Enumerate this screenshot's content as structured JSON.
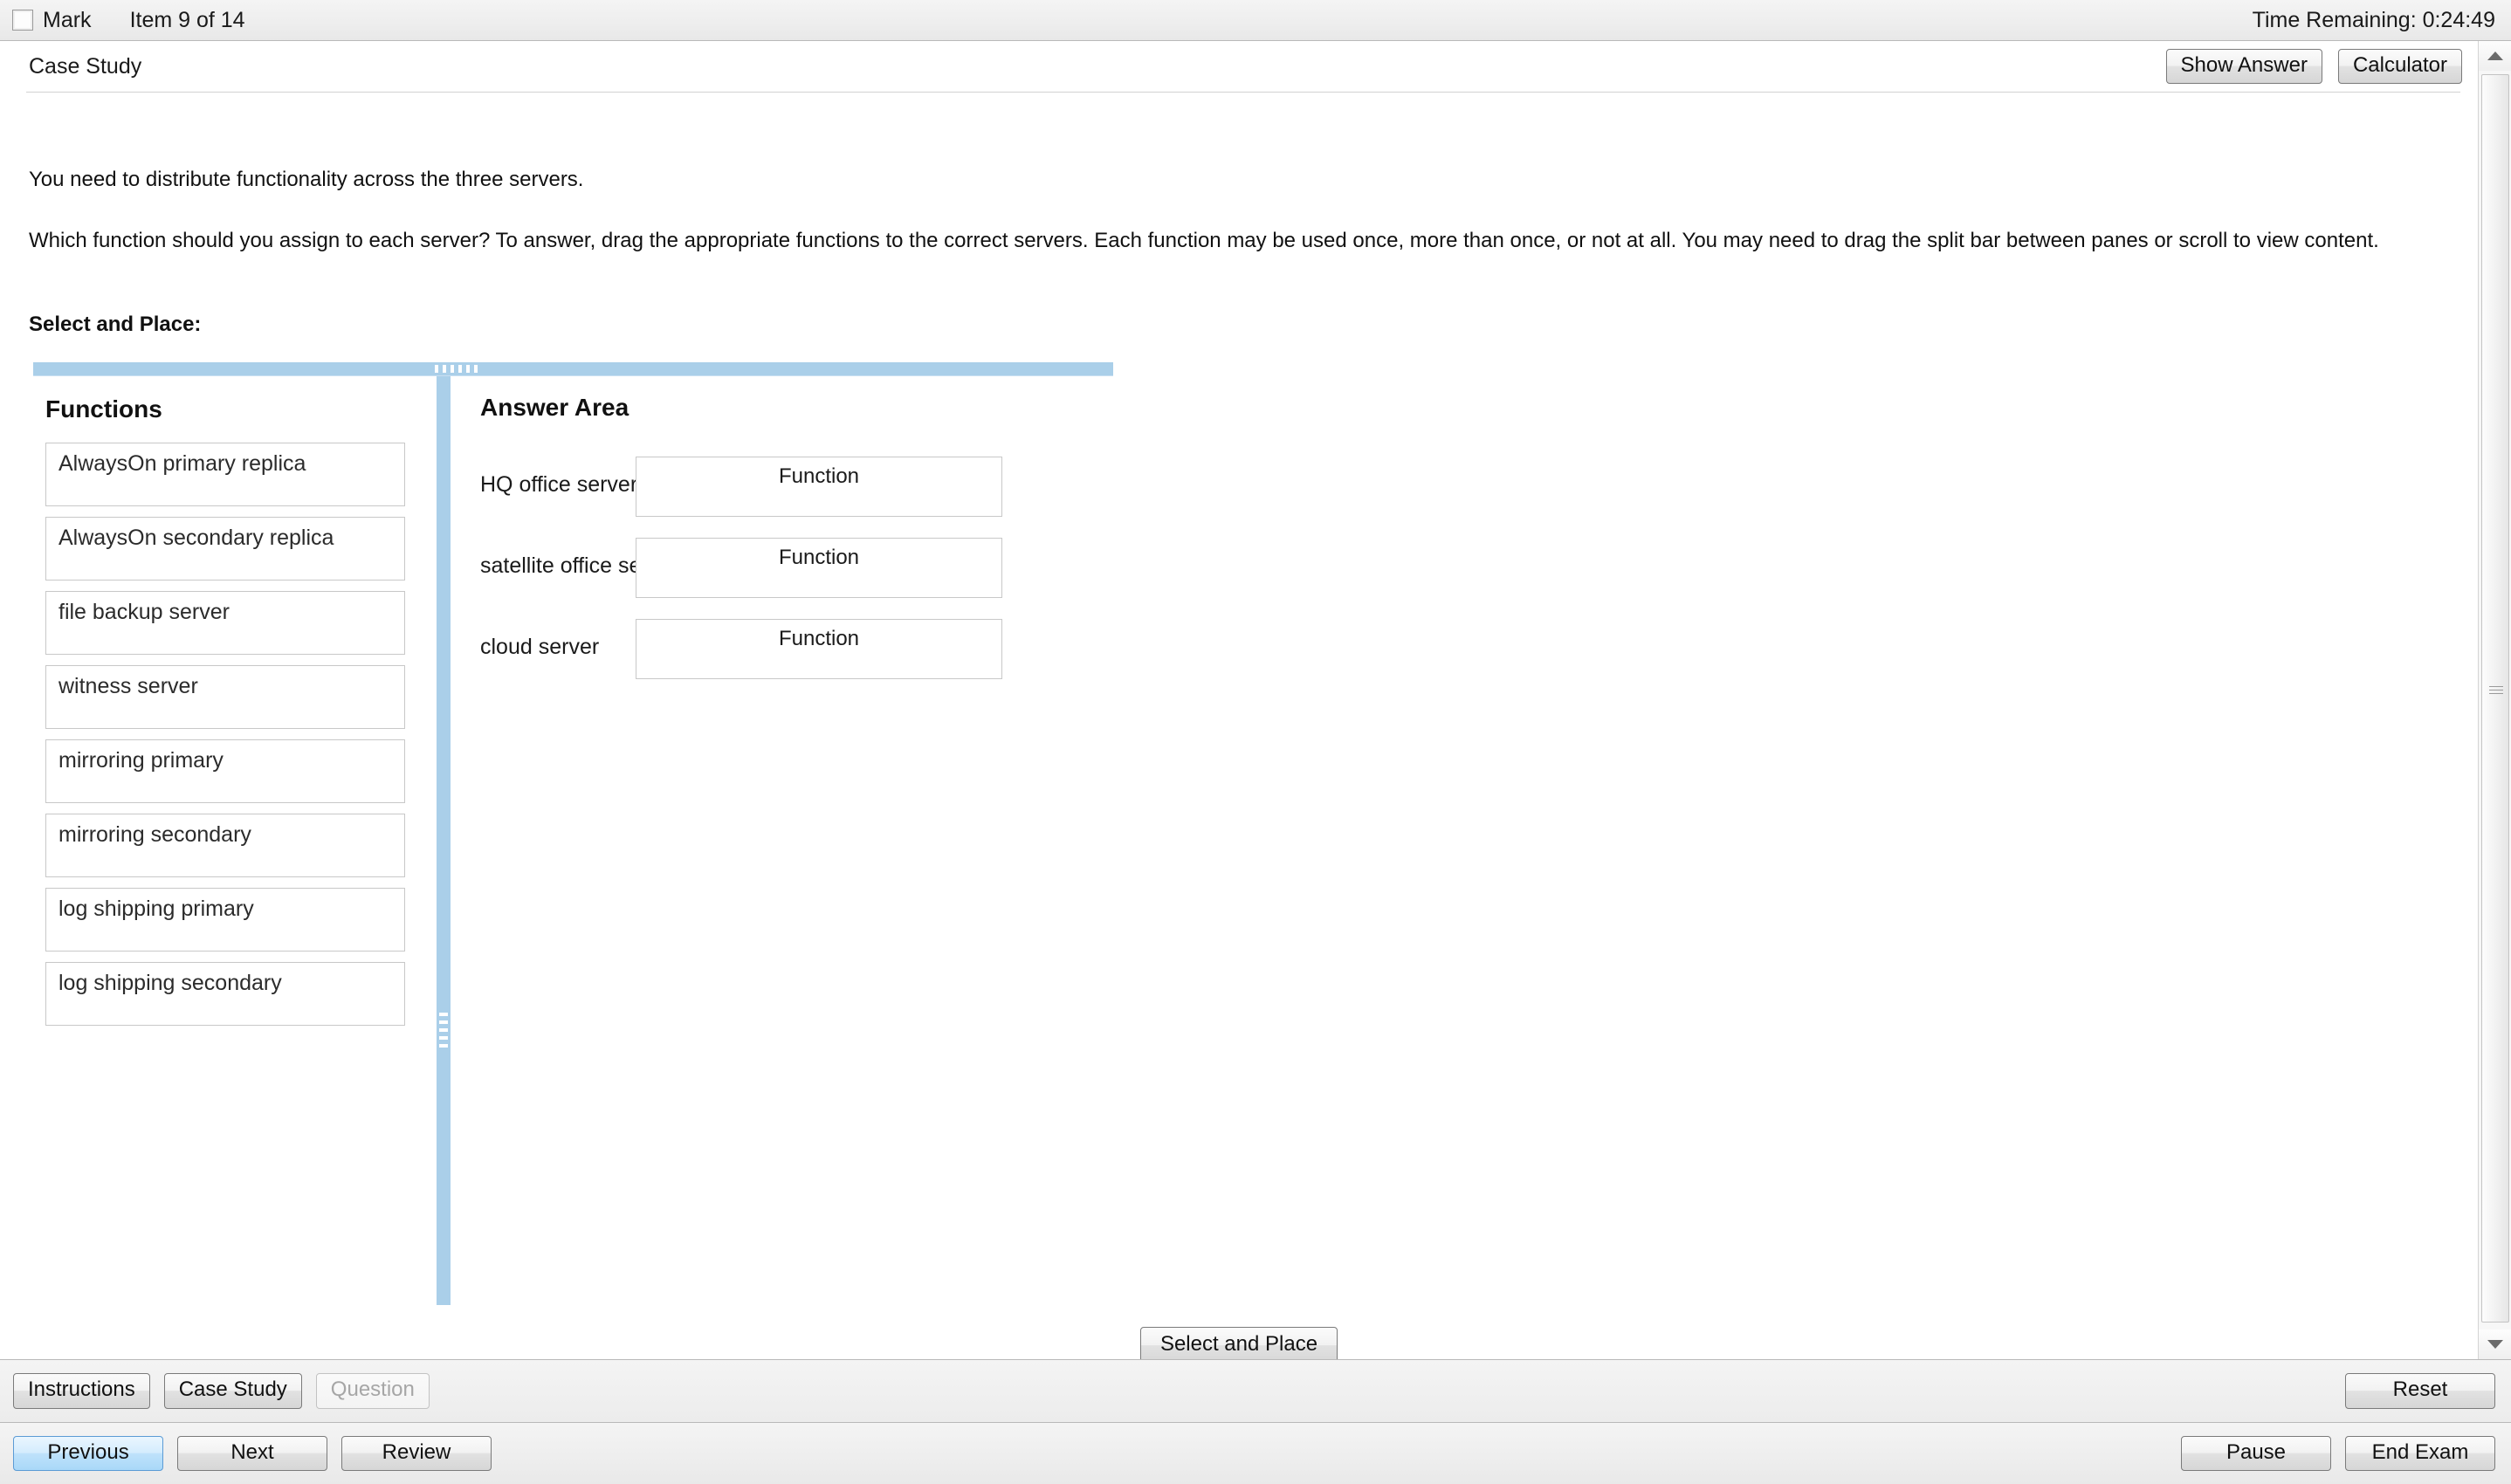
{
  "topbar": {
    "mark_label": "Mark",
    "item_count": "Item 9 of 14",
    "time_remaining": "Time Remaining: 0:24:49"
  },
  "question": {
    "type_label": "Case Study",
    "show_answer_label": "Show Answer",
    "calculator_label": "Calculator",
    "paragraph1": "You need to distribute functionality across the three servers.",
    "paragraph2": "Which function should you assign to each server? To answer, drag the appropriate functions to the correct servers. Each function may be used once, more than once, or not at all. You may need to drag the split bar between panes or scroll to view content.",
    "instruction_label": "Select and Place:",
    "action_button_label": "Select and Place"
  },
  "functions_pane": {
    "title": "Functions",
    "items": [
      "AlwaysOn primary replica",
      "AlwaysOn secondary replica",
      "file backup server",
      "witness server",
      "mirroring primary",
      "mirroring secondary",
      "log shipping primary",
      "log shipping secondary"
    ]
  },
  "answer_pane": {
    "title": "Answer Area",
    "rows": [
      {
        "label": "HQ office server",
        "drop_placeholder": "Function"
      },
      {
        "label": "satellite office server",
        "drop_placeholder": "Function"
      },
      {
        "label": "cloud server",
        "drop_placeholder": "Function"
      }
    ]
  },
  "bottom": {
    "instructions_label": "Instructions",
    "case_study_label": "Case Study",
    "question_label": "Question",
    "reset_label": "Reset",
    "previous_label": "Previous",
    "next_label": "Next",
    "review_label": "Review",
    "pause_label": "Pause",
    "end_exam_label": "End Exam"
  },
  "colors": {
    "splitter": "#aacfe9",
    "focus_blue": "#5b9bd5",
    "chrome_gray": "#eeeeee"
  }
}
